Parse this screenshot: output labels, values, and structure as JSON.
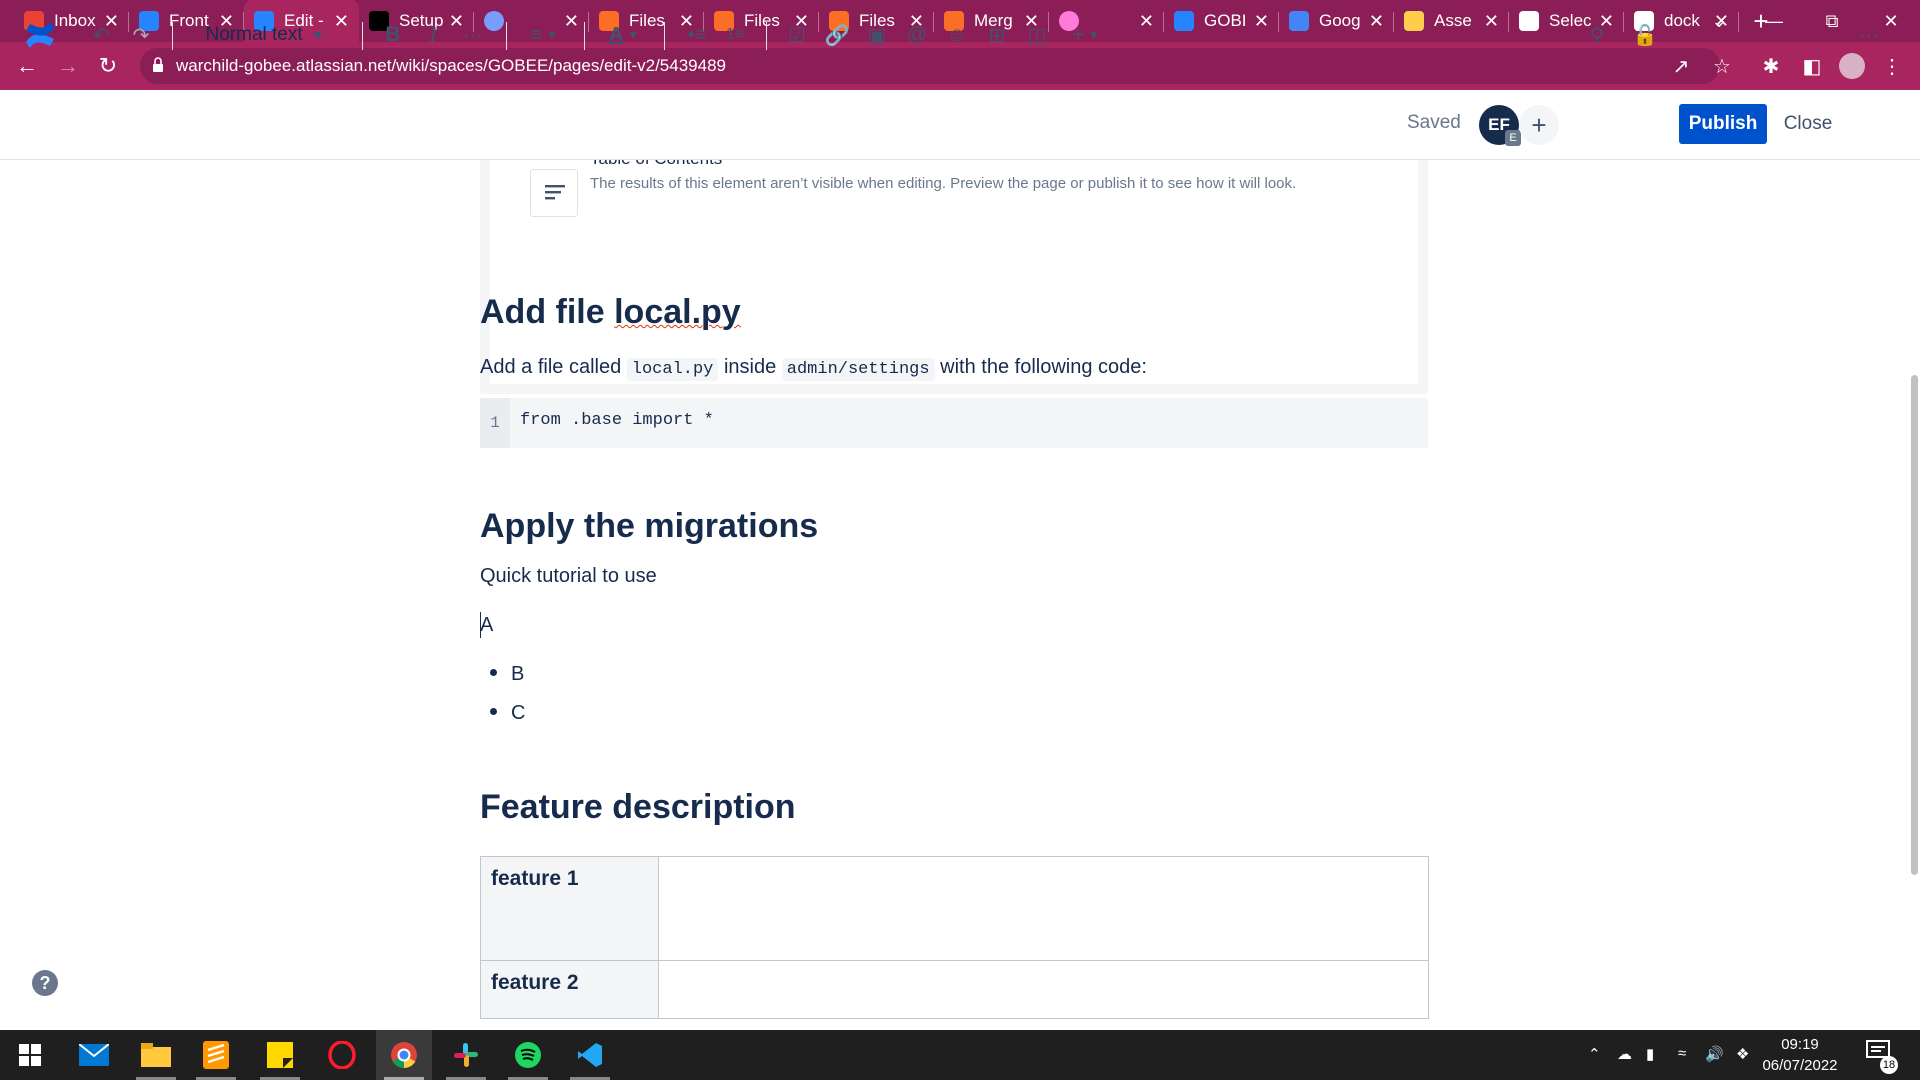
{
  "browser": {
    "tabs": [
      {
        "title": "Inbox",
        "icon": "gmail-icon",
        "color": "#ea4335"
      },
      {
        "title": "Front",
        "icon": "confluence-icon",
        "color": "#2684ff"
      },
      {
        "title": "Edit - ",
        "icon": "confluence-icon",
        "color": "#2684ff",
        "active": true
      },
      {
        "title": "Setup",
        "icon": "notion-icon",
        "color": "#000000"
      },
      {
        "title": "",
        "icon": "circle-icon",
        "color": "#7b9cff"
      },
      {
        "title": "Files",
        "icon": "gitlab-icon",
        "color": "#fc6d26"
      },
      {
        "title": "Files",
        "icon": "gitlab-icon",
        "color": "#fc6d26"
      },
      {
        "title": "Files",
        "icon": "gitlab-icon",
        "color": "#fc6d26"
      },
      {
        "title": "Merg",
        "icon": "gitlab-icon",
        "color": "#fc6d26"
      },
      {
        "title": "",
        "icon": "circle-icon",
        "color": "#ff7ad9"
      },
      {
        "title": "GOBI",
        "icon": "jira-icon",
        "color": "#2684ff"
      },
      {
        "title": "Goog",
        "icon": "google-translate-icon",
        "color": "#4285f4"
      },
      {
        "title": "Asse",
        "icon": "emoji-icon",
        "color": "#ffcc4d"
      },
      {
        "title": "Selec",
        "icon": "globe-icon",
        "color": "#ffffff"
      },
      {
        "title": "dock",
        "icon": "google-icon",
        "color": "#ffffff"
      }
    ],
    "url": "warchild-gobee.atlassian.net/wiki/spaces/GOBEE/pages/edit-v2/5439489"
  },
  "toolbar": {
    "text_style": "Normal text",
    "saved_label": "Saved",
    "avatar_initials": "EF",
    "avatar_badge": "E",
    "publish_label": "Publish",
    "close_label": "Close"
  },
  "doc": {
    "toc": {
      "title": "Table of Contents",
      "description": "The results of this element aren’t visible when editing. Preview the page or publish it to see how it will look."
    },
    "section1": {
      "heading_prefix": "Add file ",
      "heading_link": "local.py",
      "para_prefix": "Add a file called ",
      "code1": "local.py",
      "para_mid": " inside ",
      "code2": "admin/settings",
      "para_suffix": " with the following code:",
      "code_line_no": "1",
      "code_line": "from .base import *"
    },
    "section2": {
      "heading": "Apply the migrations",
      "para": "Quick tutorial to use",
      "line_a": "A",
      "bullets": [
        "B",
        "C"
      ]
    },
    "section3": {
      "heading": "Feature description",
      "rows": [
        "feature 1",
        "feature 2"
      ]
    }
  },
  "taskbar": {
    "time": "09:19",
    "date": "06/07/2022",
    "notification_count": "18"
  },
  "colors": {
    "brand_tabbar": "#8b1e56",
    "brand_addressbar": "#a8255f",
    "publish": "#0052cc",
    "text": "#172b4d"
  }
}
